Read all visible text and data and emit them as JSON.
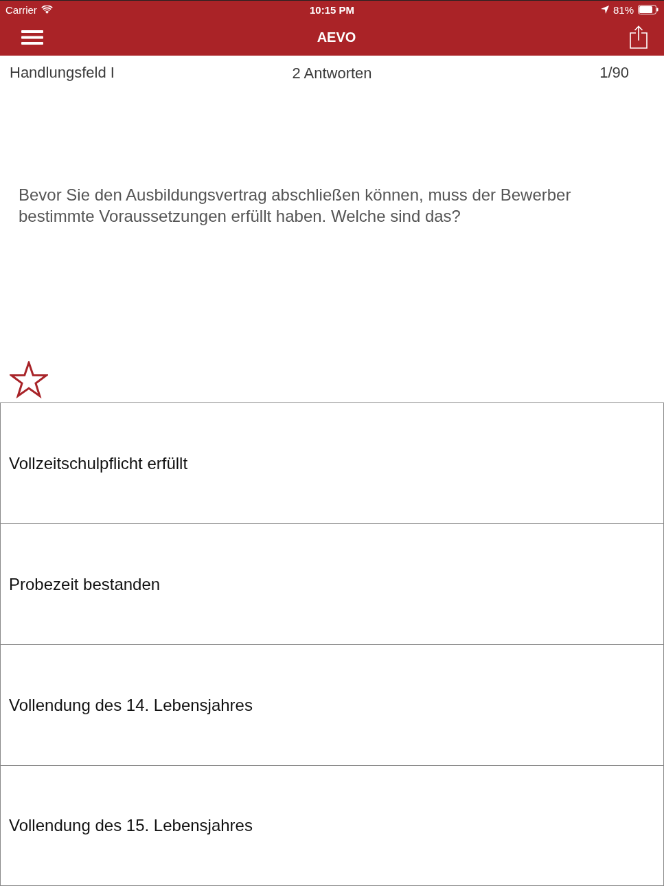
{
  "status_bar": {
    "carrier": "Carrier",
    "time": "10:15 PM",
    "battery": "81%"
  },
  "nav_bar": {
    "title": "AEVO"
  },
  "question_header": {
    "category": "Handlungsfeld I",
    "answer_count": "2 Antworten",
    "progress": "1/90"
  },
  "question": {
    "text": "Bevor Sie den Ausbildungsvertrag abschließen können, muss der Bewerber bestimmte Voraussetzungen erfüllt haben. Welche sind das?",
    "favorite": false
  },
  "answers": [
    {
      "text": "Vollzeitschulpflicht erfüllt"
    },
    {
      "text": "Probezeit bestanden"
    },
    {
      "text": "Vollendung des 14. Lebensjahres"
    },
    {
      "text": "Vollendung des 15. Lebensjahres"
    }
  ]
}
